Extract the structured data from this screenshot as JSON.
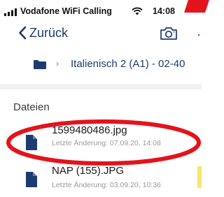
{
  "status_bar": {
    "carrier": "Vodafone WiFi Calling",
    "time": "14:08"
  },
  "nav": {
    "back_label": "Zurück",
    "icons": [
      "chevron-left-icon",
      "camera-icon"
    ]
  },
  "breadcrumb": {
    "current": "Italienisch 2 (A1) - 02-40"
  },
  "section": {
    "title": "Dateien"
  },
  "files": [
    {
      "name": "1599480486.jpg",
      "meta": "Letzte Änderung: 07.09.20, 14:08"
    },
    {
      "name": "NAP (155).JPG",
      "meta": "Letzte Änderung: 03.09.20, 10:36"
    }
  ],
  "colors": {
    "accent": "#1d3b6e",
    "annotation": "#e4131b",
    "muted": "#9a9a9a"
  }
}
